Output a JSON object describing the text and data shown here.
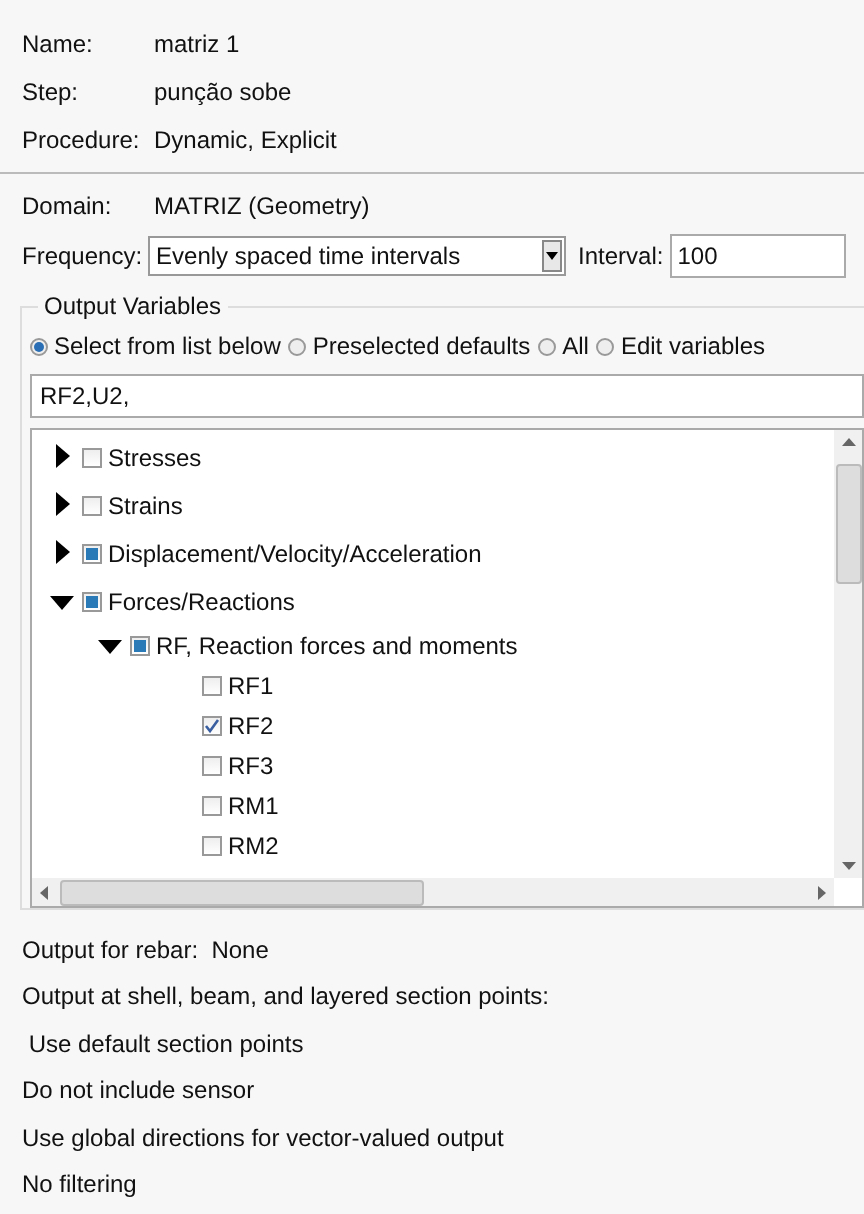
{
  "info": [
    {
      "label": "Name:",
      "value": "matriz 1"
    },
    {
      "label": "Step:",
      "value": "punção sobe"
    },
    {
      "label": "Procedure:",
      "value": "Dynamic, Explicit"
    }
  ],
  "domain": {
    "label": "Domain:",
    "value": "MATRIZ (Geometry)"
  },
  "frequency": {
    "label": "Frequency:",
    "value": "Evenly spaced time intervals",
    "interval_label": "Interval:",
    "interval": "100"
  },
  "output_variables": {
    "title": "Output Variables",
    "options": [
      {
        "label": "Select from list below",
        "selected": true
      },
      {
        "label": "Preselected defaults",
        "selected": false
      },
      {
        "label": "All",
        "selected": false
      },
      {
        "label": "Edit variables",
        "selected": false
      }
    ],
    "field": "RF2,U2,",
    "tree": [
      {
        "label": "Stresses",
        "expanded": false,
        "checked": false,
        "partial": false
      },
      {
        "label": "Strains",
        "expanded": false,
        "checked": false,
        "partial": false
      },
      {
        "label": "Displacement/Velocity/Acceleration",
        "expanded": false,
        "checked": false,
        "partial": true
      },
      {
        "label": "Forces/Reactions",
        "expanded": true,
        "checked": false,
        "partial": true,
        "children": [
          {
            "label": "RF, Reaction forces and moments",
            "expanded": true,
            "checked": false,
            "partial": true,
            "children": [
              {
                "label": "RF1",
                "checked": false,
                "partial": false
              },
              {
                "label": "RF2",
                "checked": true,
                "partial": false
              },
              {
                "label": "RF3",
                "checked": false,
                "partial": false
              },
              {
                "label": "RM1",
                "checked": false,
                "partial": false
              },
              {
                "label": "RM2",
                "checked": false,
                "partial": false
              }
            ]
          }
        ]
      }
    ]
  },
  "notes": [
    "Output for rebar:  None",
    "Output at shell, beam, and layered section points:",
    " Use default section points",
    "Do not include sensor",
    "Use global directions for vector-valued output",
    "No filtering"
  ]
}
